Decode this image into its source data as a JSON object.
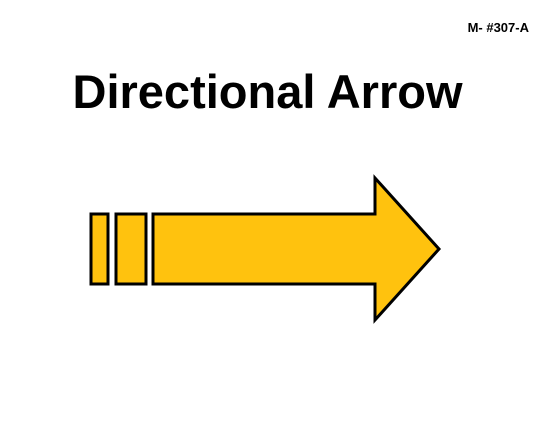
{
  "header": {
    "code": "M- #307-A"
  },
  "main": {
    "title": "Directional Arrow"
  },
  "graphic": {
    "icon": "right-arrow-icon",
    "fill_color": "#FFC20E",
    "stroke_color": "#000000"
  }
}
